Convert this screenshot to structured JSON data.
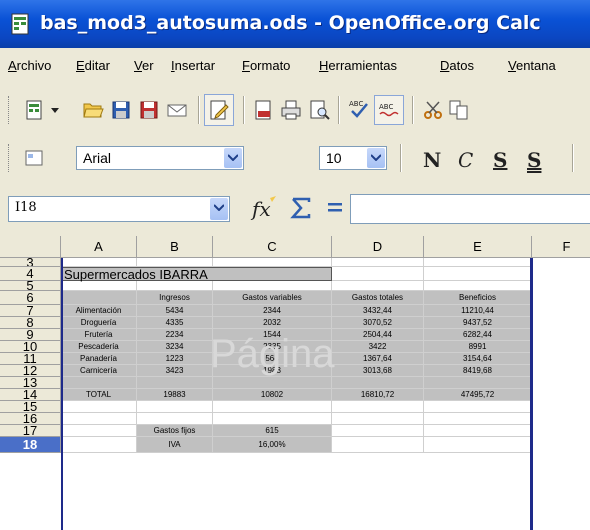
{
  "window": {
    "title": "bas_mod3_autosuma.ods - OpenOffice.org Calc"
  },
  "menu": {
    "items": [
      "Archivo",
      "Editar",
      "Ver",
      "Insertar",
      "Formato",
      "Herramientas",
      "Datos",
      "Ventana"
    ]
  },
  "font_toolbar": {
    "font_name": "Arial",
    "font_size": "10",
    "bold": "N",
    "italic": "C",
    "underline": "S",
    "underline2": "S"
  },
  "formula_bar": {
    "cell_ref": "I18",
    "content": ""
  },
  "sheet": {
    "columns": [
      "A",
      "B",
      "C",
      "D",
      "E",
      "F"
    ],
    "rows": [
      "3",
      "4",
      "5",
      "6",
      "7",
      "8",
      "9",
      "10",
      "11",
      "12",
      "13",
      "14",
      "15",
      "16",
      "17",
      "18"
    ],
    "active_row": "18",
    "watermark": "Página",
    "title_cell": "Supermercados IBARRA",
    "headers": [
      "Ingresos",
      "Gastos variables",
      "Gastos totales",
      "Beneficios"
    ],
    "data": [
      [
        "Alimentación",
        "5434",
        "2344",
        "3432,44",
        "11210,44"
      ],
      [
        "Droguería",
        "4335",
        "2032",
        "3070,52",
        "9437,52"
      ],
      [
        "Frutería",
        "2234",
        "1544",
        "2504,44",
        "6282,44"
      ],
      [
        "Pescadería",
        "3234",
        "2335",
        "3422",
        "8991"
      ],
      [
        "Panadería",
        "1223",
        "564",
        "1367,64",
        "3154,64"
      ],
      [
        "Carnicería",
        "3423",
        "1983",
        "3013,68",
        "8419,68"
      ]
    ],
    "total": [
      "TOTAL",
      "19883",
      "10802",
      "16810,72",
      "47495,72"
    ],
    "gastos_fijos": {
      "label": "Gastos fijos",
      "value": "615"
    },
    "iva": {
      "label": "IVA",
      "value": "16,00%"
    }
  }
}
